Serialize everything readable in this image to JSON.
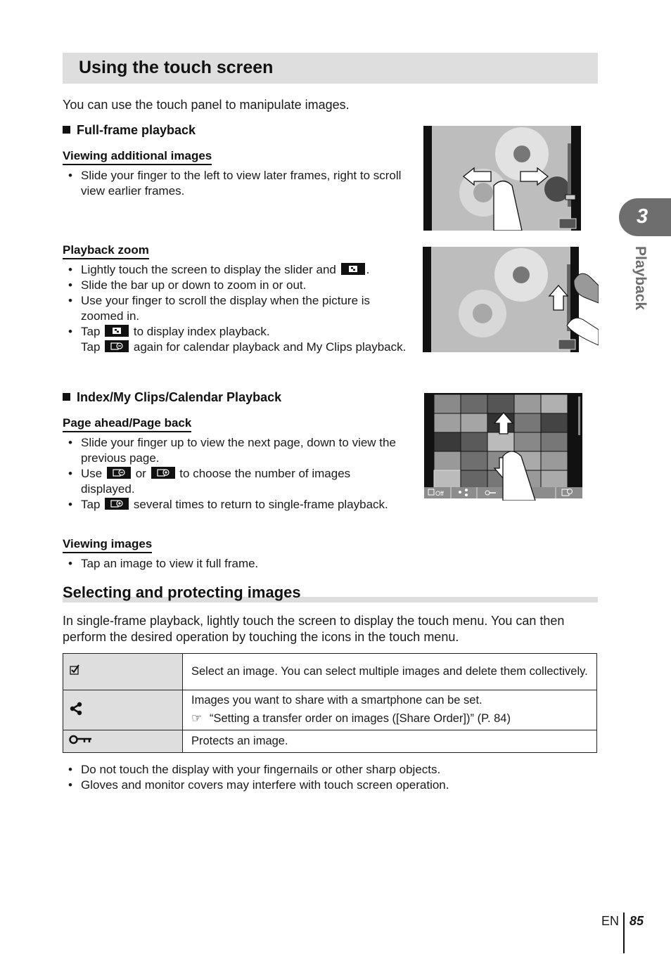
{
  "page": {
    "title": "Using the touch screen",
    "intro": "You can use the touch panel to manipulate images.",
    "chapter_tab": {
      "number": "3",
      "label": "Playback"
    },
    "footer": {
      "lang": "EN",
      "page_number": "85"
    }
  },
  "full_frame": {
    "heading": "Full-frame playback",
    "viewing_additional": {
      "subheading": "Viewing additional images",
      "bullets": [
        "Slide your finger to the left to view later frames, right to scroll view earlier frames."
      ]
    },
    "playback_zoom": {
      "subheading": "Playback zoom",
      "bullet1_pre": "Lightly touch the screen to display the slider and",
      "bullet1_post": ".",
      "bullet2": "Slide the bar up or down to zoom in or out.",
      "bullet3": "Use your finger to scroll the display when the picture is zoomed in.",
      "bullet4_a_pre": "Tap",
      "bullet4_a_post": "to display index playback.",
      "bullet4_b_pre": "Tap",
      "bullet4_b_post": "again for calendar playback and My Clips playback."
    }
  },
  "index": {
    "heading": "Index/My Clips/Calendar Playback",
    "page_ahead": {
      "subheading": "Page ahead/Page back",
      "bullet1": "Slide your finger up to view the next page, down to view the previous page.",
      "bullet2_pre": "Use",
      "bullet2_mid": "or",
      "bullet2_post": "to choose the number of images displayed.",
      "bullet3_pre": "Tap",
      "bullet3_post": "several times to return to single-frame playback."
    },
    "viewing_images": {
      "subheading": "Viewing images",
      "bullet1": "Tap an image to view it full frame."
    },
    "touch_menu": [
      "Off",
      "share",
      "protect",
      "",
      "index-out",
      "index-in"
    ]
  },
  "selecting": {
    "heading": "Selecting and protecting images",
    "paragraph": "In single-frame playback, lightly touch the screen to display the touch menu. You can then perform the desired operation by touching the icons in the touch menu.",
    "rows": [
      {
        "icon": "checkbox-icon",
        "text": "Select an image. You can select multiple images and delete them collectively."
      },
      {
        "icon": "share-icon",
        "text": "Images you want to share with a smartphone can be set.",
        "ref": "“Setting a transfer order on images ([Share Order])” (P. 84)"
      },
      {
        "icon": "key-icon",
        "text": "Protects an image."
      }
    ],
    "notes": [
      "Do not touch the display with your fingernails or other sharp objects.",
      "Gloves and monitor covers may interfere with touch screen operation."
    ]
  }
}
